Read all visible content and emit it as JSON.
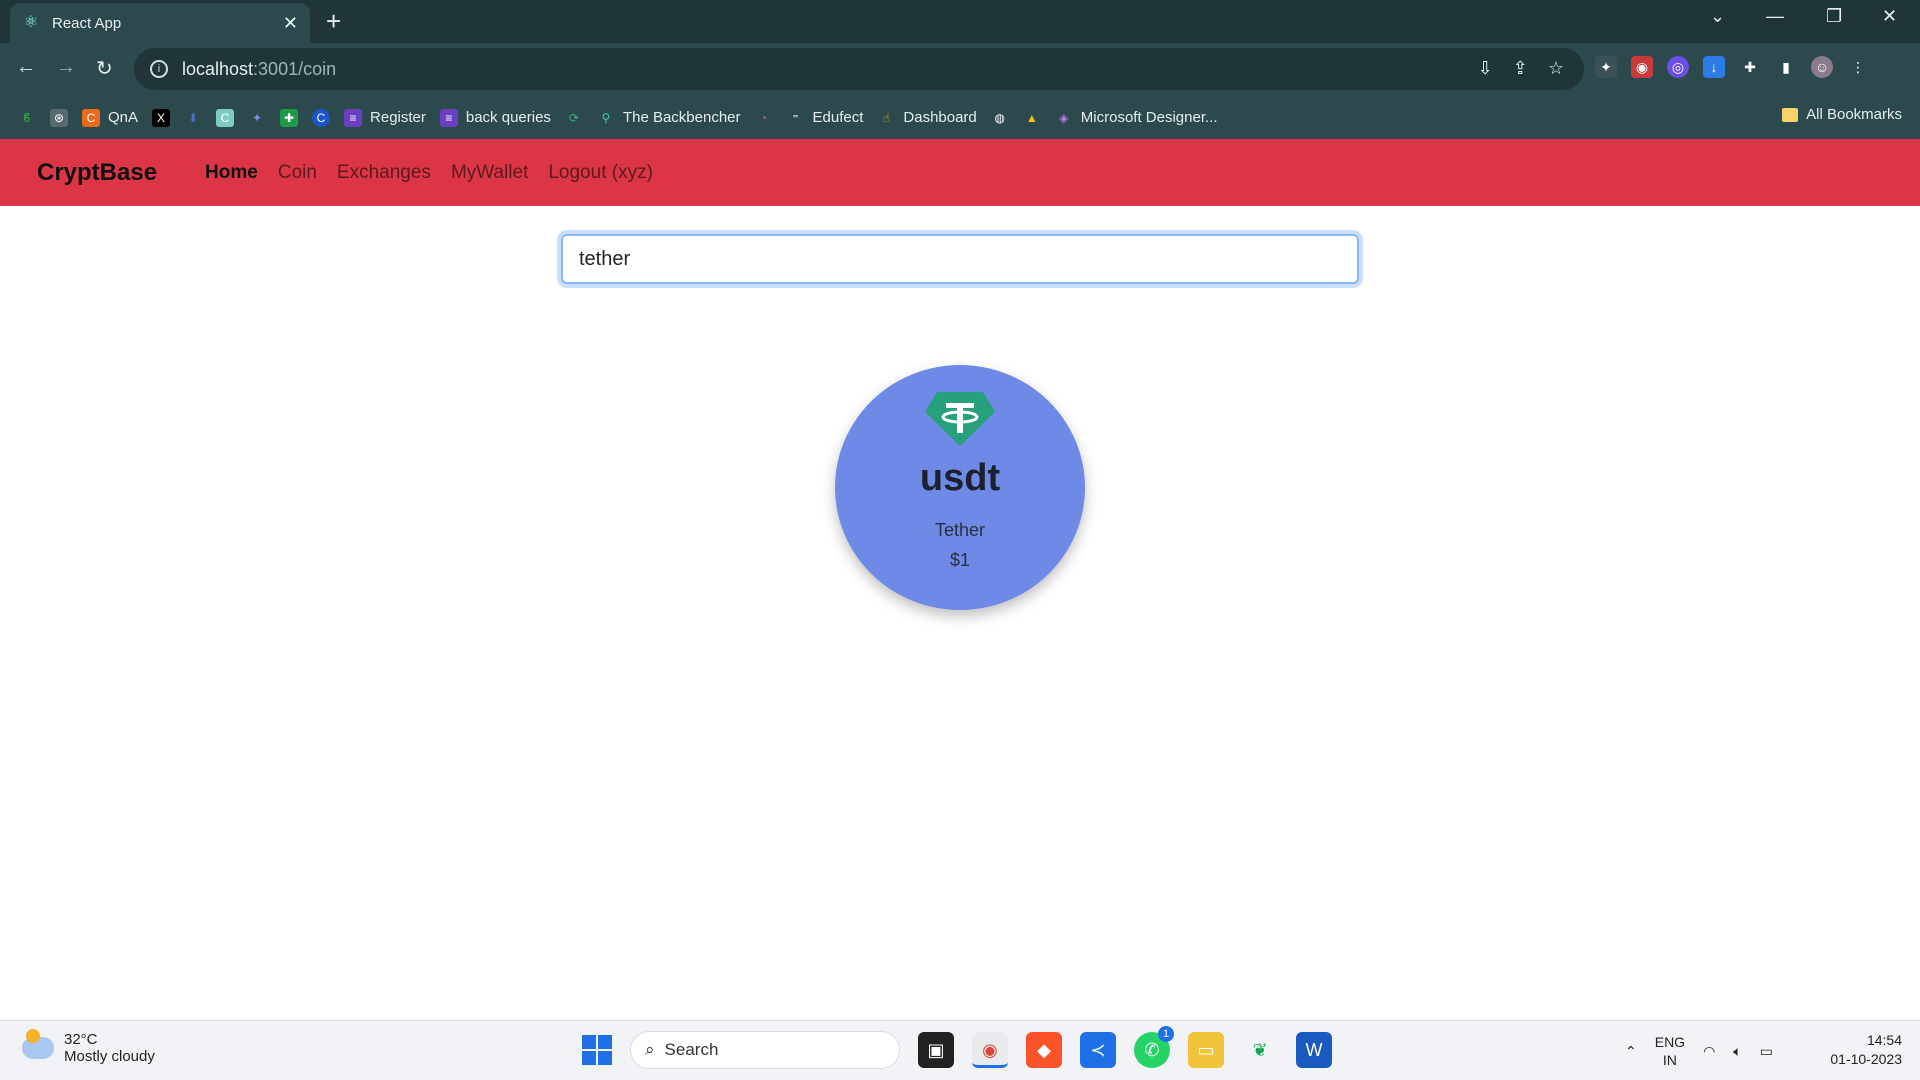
{
  "browser": {
    "tab_title": "React App",
    "url_host": "localhost",
    "url_path": ":3001/coin",
    "bookmarks": [
      "",
      "",
      "QnA",
      "",
      "",
      "",
      "",
      "",
      "",
      "Register",
      "back queries",
      "",
      "The Backbencher",
      "",
      "Edufect",
      "Dashboard",
      "",
      "",
      "Microsoft Designer..."
    ],
    "all_bookmarks": "All Bookmarks"
  },
  "app": {
    "brand": "CryptBase",
    "nav": [
      "Home",
      "Coin",
      "Exchanges",
      "MyWallet",
      "Logout (xyz)"
    ]
  },
  "search": {
    "value": "tether"
  },
  "coin": {
    "symbol": "usdt",
    "name": "Tether",
    "price": "$1",
    "logo_color": "#26a17b",
    "card_color": "#6f8ae6"
  },
  "taskbar": {
    "temperature": "32°C",
    "weather": "Mostly cloudy",
    "search_label": "Search",
    "whatsapp_badge": "1",
    "lang_top": "ENG",
    "lang_bottom": "IN",
    "time": "14:54",
    "date": "01-10-2023"
  }
}
